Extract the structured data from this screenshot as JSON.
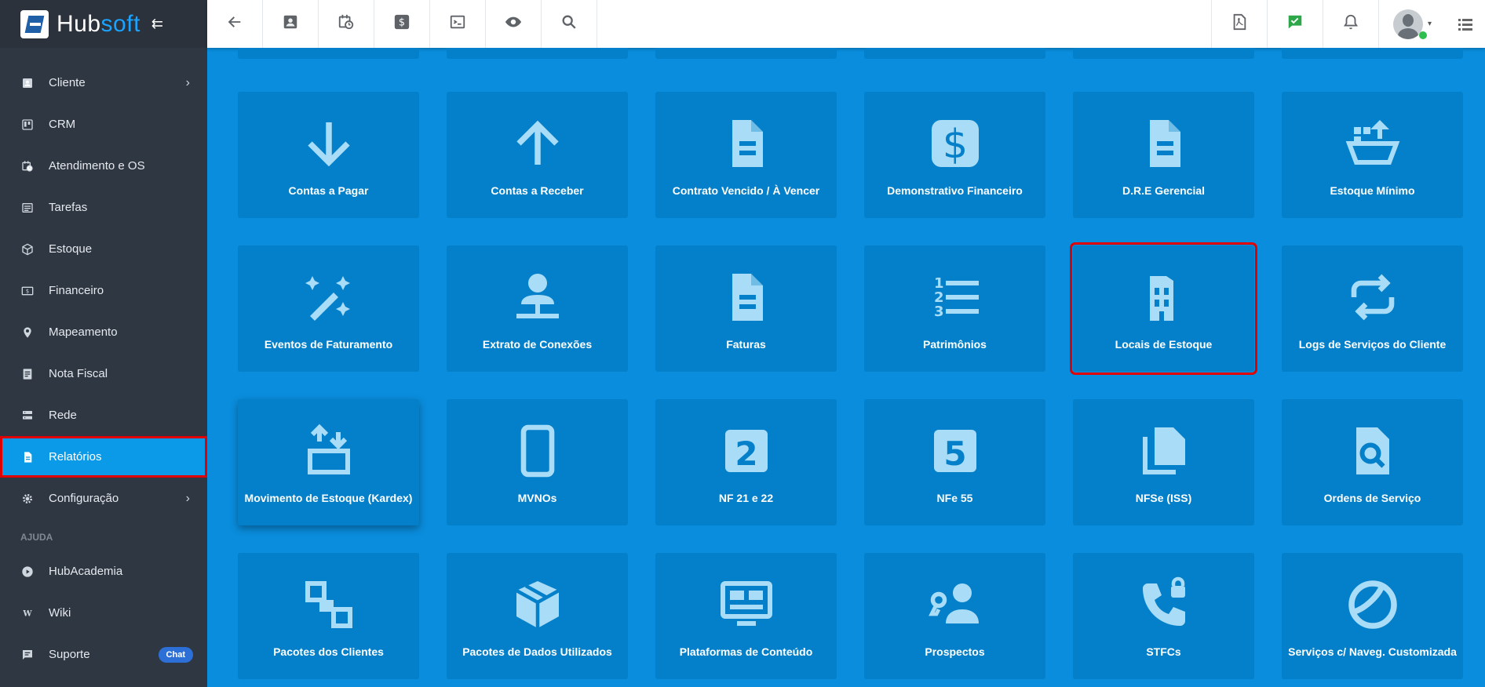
{
  "brand": {
    "hub": "Hub",
    "soft": "soft"
  },
  "sidebar": {
    "items": [
      {
        "label": "Cliente",
        "icon": "contact-card-icon",
        "has_children": true
      },
      {
        "label": "CRM",
        "icon": "board-icon"
      },
      {
        "label": "Atendimento e OS",
        "icon": "calendar-clock-icon"
      },
      {
        "label": "Tarefas",
        "icon": "tasks-icon"
      },
      {
        "label": "Estoque",
        "icon": "box-icon"
      },
      {
        "label": "Financeiro",
        "icon": "money-icon"
      },
      {
        "label": "Mapeamento",
        "icon": "map-pin-icon"
      },
      {
        "label": "Nota Fiscal",
        "icon": "invoice-icon"
      },
      {
        "label": "Rede",
        "icon": "network-icon"
      },
      {
        "label": "Relatórios",
        "icon": "report-icon",
        "active": true
      },
      {
        "label": "Configuração",
        "icon": "gear-icon",
        "has_children": true
      }
    ],
    "help_section": "AJUDA",
    "help_items": [
      {
        "label": "HubAcademia",
        "icon": "play-icon"
      },
      {
        "label": "Wiki",
        "icon": "wikipedia-icon"
      },
      {
        "label": "Suporte",
        "icon": "chat-icon",
        "badge": "Chat"
      }
    ]
  },
  "topbar": {
    "left_buttons": [
      "back-arrow-icon",
      "contact-card-icon",
      "calendar-clock-icon",
      "dollar-icon",
      "terminal-icon",
      "eye-icon",
      "search-icon"
    ],
    "right_buttons": [
      "pdf-icon",
      "chat-check-icon",
      "bell-icon"
    ]
  },
  "reports": [
    {
      "label": "Contas a Pagar",
      "icon": "arrow-down-icon"
    },
    {
      "label": "Contas a Receber",
      "icon": "arrow-up-icon"
    },
    {
      "label": "Contrato Vencido / À Vencer",
      "icon": "document-icon"
    },
    {
      "label": "Demonstrativo Financeiro",
      "icon": "dollar-box-icon"
    },
    {
      "label": "D.R.E Gerencial",
      "icon": "document-icon"
    },
    {
      "label": "Estoque Mínimo",
      "icon": "basket-upload-icon"
    },
    {
      "label": "Eventos de Faturamento",
      "icon": "magic-wand-icon"
    },
    {
      "label": "Extrato de Conexões",
      "icon": "account-network-icon"
    },
    {
      "label": "Faturas",
      "icon": "document-icon"
    },
    {
      "label": "Patrimônios",
      "icon": "ordered-list-icon"
    },
    {
      "label": "Locais de Estoque",
      "icon": "building-icon",
      "highlight": true
    },
    {
      "label": "Logs de Serviços do Cliente",
      "icon": "repeat-icon"
    },
    {
      "label": "Movimento de Estoque (Kardex)",
      "icon": "transfer-box-icon",
      "raised": true
    },
    {
      "label": "MVNOs",
      "icon": "phone-icon"
    },
    {
      "label": "NF 21 e 22",
      "icon": "numeric-2-box-icon"
    },
    {
      "label": "NFe 55",
      "icon": "numeric-5-box-icon"
    },
    {
      "label": "NFSe (ISS)",
      "icon": "documents-icon"
    },
    {
      "label": "Ordens de Serviço",
      "icon": "file-search-icon"
    },
    {
      "label": "Pacotes dos Clientes",
      "icon": "package-squares-icon"
    },
    {
      "label": "Pacotes de Dados Utilizados",
      "icon": "package-icon"
    },
    {
      "label": "Plataformas de Conteúdo",
      "icon": "monitor-dashboard-icon"
    },
    {
      "label": "Prospectos",
      "icon": "account-key-icon"
    },
    {
      "label": "STFCs",
      "icon": "phone-lock-icon"
    },
    {
      "label": "Serviços c/ Naveg. Customizada",
      "icon": "globe-icon"
    }
  ],
  "colors": {
    "sidebar_bg": "#2f3742",
    "content_bg": "#0a8ddd",
    "card_bg": "#0380c9",
    "icon_color": "#a9dcf6",
    "active_item": "#0a9ae8",
    "highlight_border": "#e00000"
  }
}
